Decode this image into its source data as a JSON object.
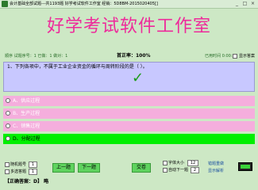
{
  "window": {
    "title": "会计基础全部试题---共1193题  好学考试软件工作室  经销：5D8BM-2015020405[]",
    "minimize": "_",
    "maximize": "□",
    "close": "×"
  },
  "banner": {
    "name": "好学考试软件工作室"
  },
  "status": {
    "mode": "顺序  试题序号：1  已做：1  做对：1",
    "accuracy": "首正率：100%",
    "elapsed": "已用时间 0:00:25",
    "show_answer_label": "显示答案"
  },
  "question": {
    "text": "1、下列各项中，不属于工业企业资金的循环与周转阶段的是（  ）。",
    "result_mark": "✓"
  },
  "options": [
    {
      "label": "A、供应过程",
      "selected": false
    },
    {
      "label": "B、生产过程",
      "selected": false
    },
    {
      "label": "C、销售过程",
      "selected": false
    },
    {
      "label": "D、分配过程",
      "selected": true
    }
  ],
  "controls": {
    "random_label": "随机题号",
    "random_value": "1",
    "multi_label": "多选答题",
    "multi_value": "1",
    "prev_button": "上一题",
    "next_button": "下一题",
    "submit_button": "交卷",
    "font_size_label": "字体大小",
    "font_size_value": "12",
    "auto_next_label": "自动下一题",
    "auto_next_value": "2",
    "review_label": "错题重做",
    "explain_label": "显示解析"
  },
  "answer": {
    "text": "【正确答案：D】  略"
  }
}
